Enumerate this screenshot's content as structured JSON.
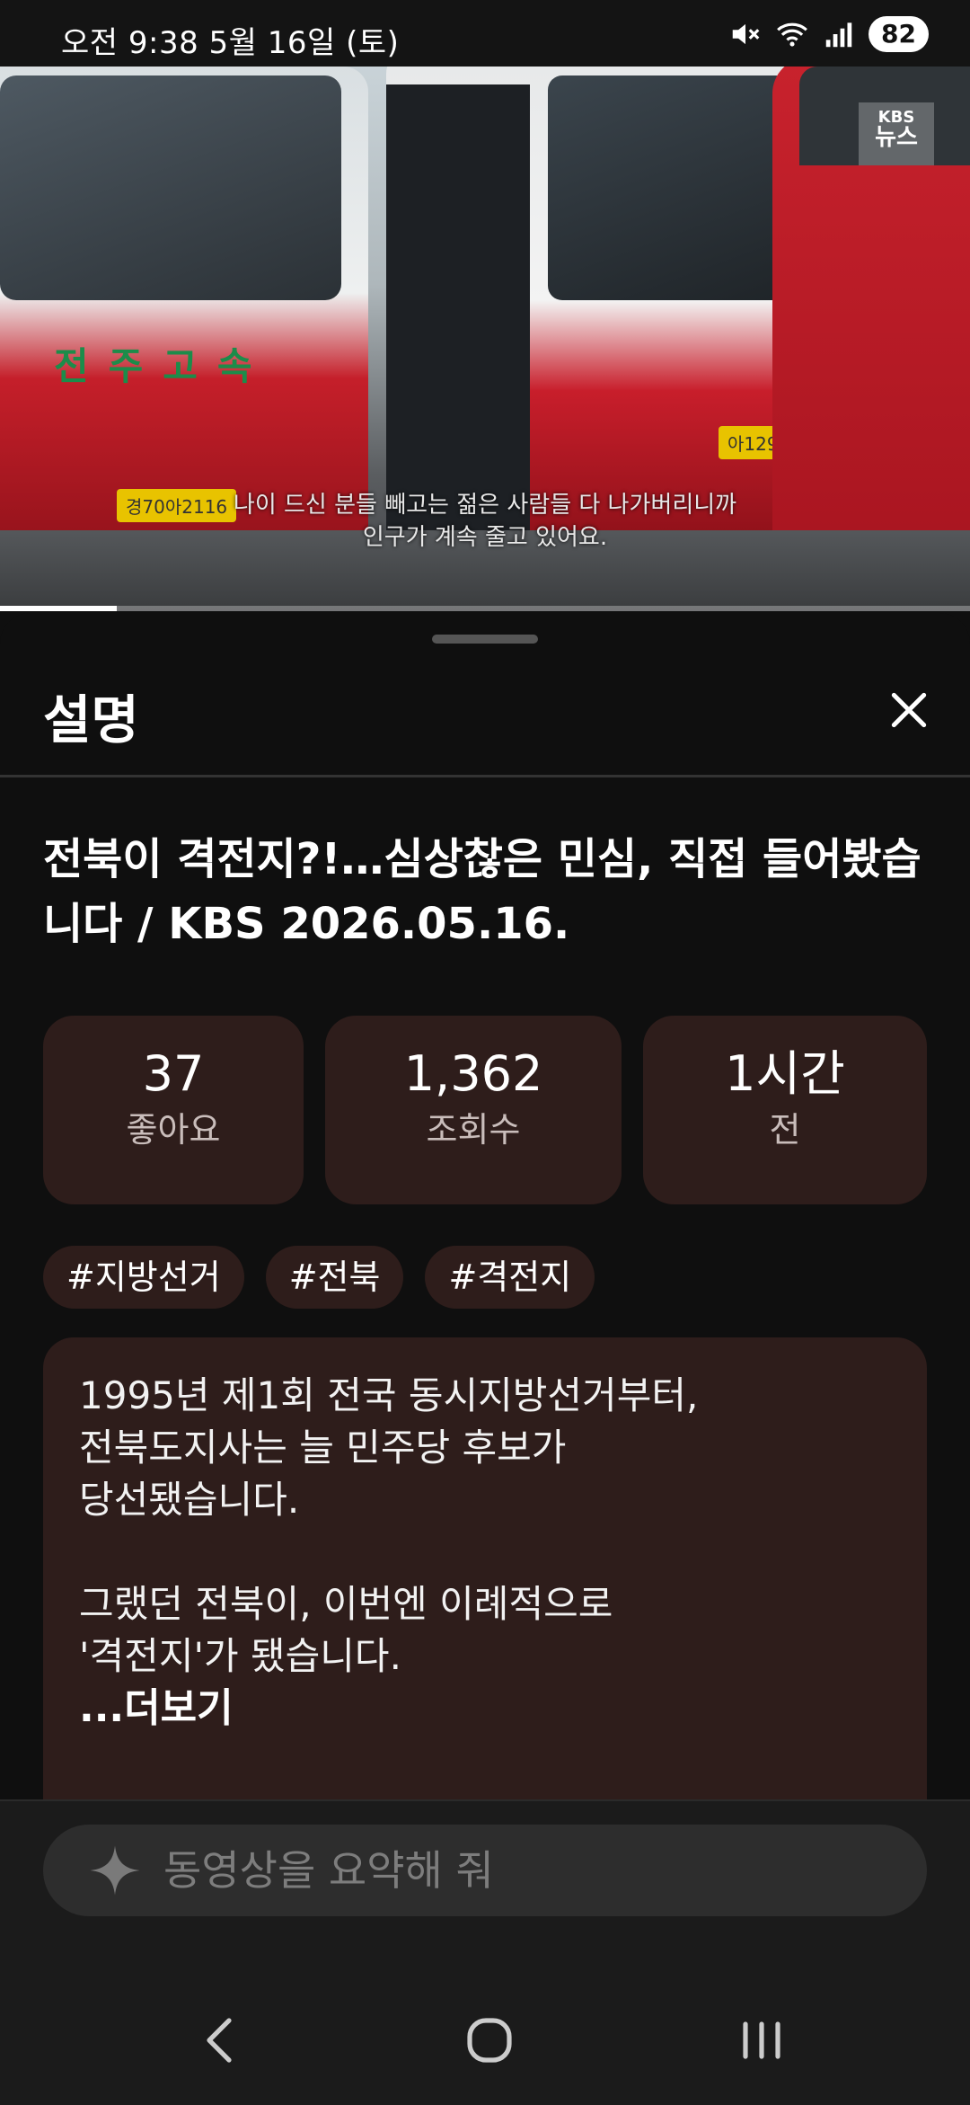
{
  "status_bar": {
    "time": "오전 9:38  5월 16일 (토)",
    "battery": "82"
  },
  "video": {
    "caption_line1": "나이 드신 분들 빼고는 젊은 사람들 다 나가버리니까",
    "caption_line2": "인구가 계속 줄고 있어요.",
    "logo_top": "KBS",
    "logo_bottom": "뉴스",
    "bus_name": "전주고속",
    "plate1": "경70아2116",
    "plate2": "아1292",
    "progress_fraction": 0.12
  },
  "sheet": {
    "title": "설명",
    "video_title": "전북이 격전지?!…심상찮은 민심, 직접 들어봤습니다 / KBS 2026.05.16.",
    "stats": [
      {
        "value": "37",
        "label": "좋아요"
      },
      {
        "value": "1,362",
        "label": "조회수"
      },
      {
        "value": "1시간",
        "label": "전"
      }
    ],
    "tags": [
      "#지방선거",
      "#전북",
      "#격전지"
    ],
    "description": {
      "line1": "1995년 제1회 전국 동시지방선거부터,",
      "line2": "전북도지사는 늘 민주당 후보가",
      "line3": "당선됐습니다.",
      "line4": "그랬던 전북이, 이번엔 이례적으로",
      "line5": "'격전지'가 됐습니다.",
      "more": "...더보기"
    }
  },
  "ai_input": {
    "placeholder": "동영상을 요약해 줘"
  },
  "colors": {
    "background": "#0f0f0f",
    "card": "#2e1d1b",
    "input": "#2d2d2d"
  }
}
